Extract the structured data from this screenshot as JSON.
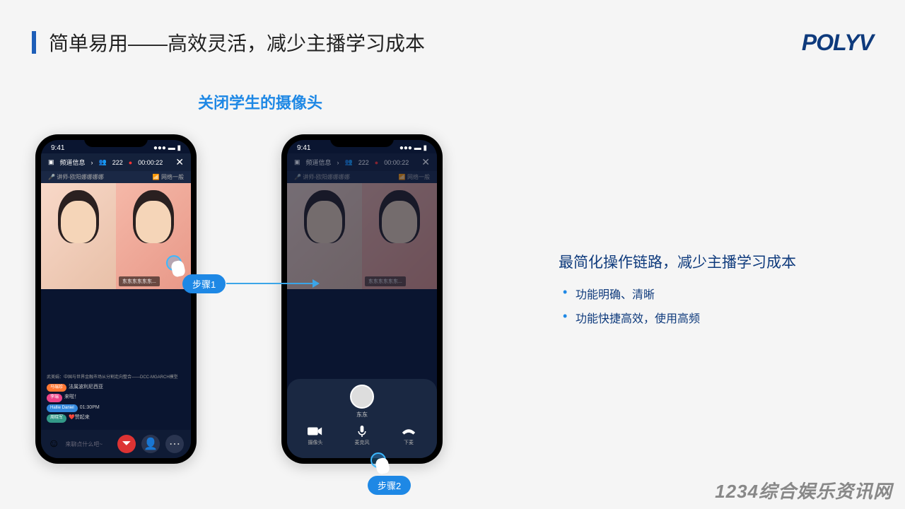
{
  "header": {
    "title": "简单易用——高效灵活，减少主播学习成本"
  },
  "logo": "POLYV",
  "subtitle": "关闭学生的摄像头",
  "phone_common": {
    "time": "9:41",
    "channel_label": "频道信息",
    "viewer_count": "222",
    "rec_time": "00:00:22",
    "teacher_label": "讲师-欧阳娜娜娜娜",
    "network_label": "网络一般",
    "video_tag": "东东东东东东..."
  },
  "phone1": {
    "chat_topic": "武美娟：中国与世界金融市场从分割走向整合——DCC-MGARCH模型",
    "chat_rows": [
      {
        "badge": "马瑞珍",
        "text": "法属波利尼西亚"
      },
      {
        "badge": "李瑞",
        "text": "来啦！"
      },
      {
        "badge": "Hallie Daniel",
        "text": "01:30PM"
      },
      {
        "badge": "周晓军",
        "text": "❤️赞起来"
      }
    ],
    "input_hint": "来聊点什么吧~"
  },
  "phone2": {
    "avatar_name": "东东",
    "controls": [
      {
        "label": "摄像头"
      },
      {
        "label": "麦克风"
      },
      {
        "label": "下麦"
      }
    ]
  },
  "steps": {
    "s1": "步骤1",
    "s2": "步骤2"
  },
  "desc": {
    "title": "最简化操作链路，减少主播学习成本",
    "bullets": [
      "功能明确、清晰",
      "功能快捷高效，使用高频"
    ]
  },
  "watermark": "1234综合娱乐资讯网"
}
